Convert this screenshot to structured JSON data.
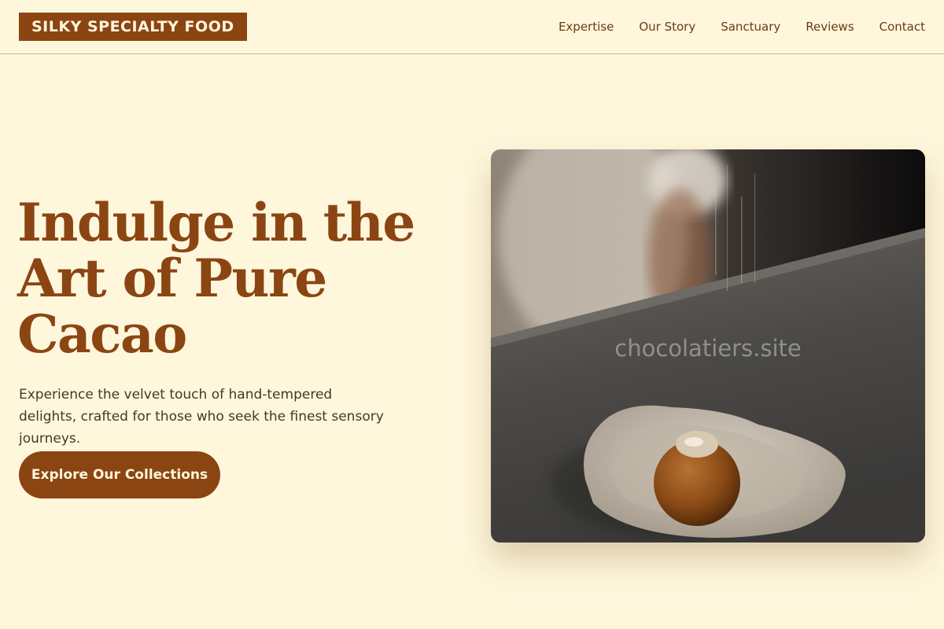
{
  "brand": {
    "name": "SILKY SPECIALTY FOOD"
  },
  "nav": {
    "items": [
      "Expertise",
      "Our Story",
      "Sanctuary",
      "Reviews",
      "Contact"
    ]
  },
  "hero": {
    "headline": "Indulge in the Art of Pure Cacao",
    "subtext": "Experience the velvet touch of hand-tempered delights, crafted for those who seek the finest sensory journeys.",
    "cta_label": "Explore Our Collections",
    "image_watermark": "chocolatiers.site"
  },
  "colors": {
    "background": "#fff7dc",
    "accent": "#8b4513",
    "nav_text": "#6b3a12",
    "body_text": "#4a3526"
  }
}
